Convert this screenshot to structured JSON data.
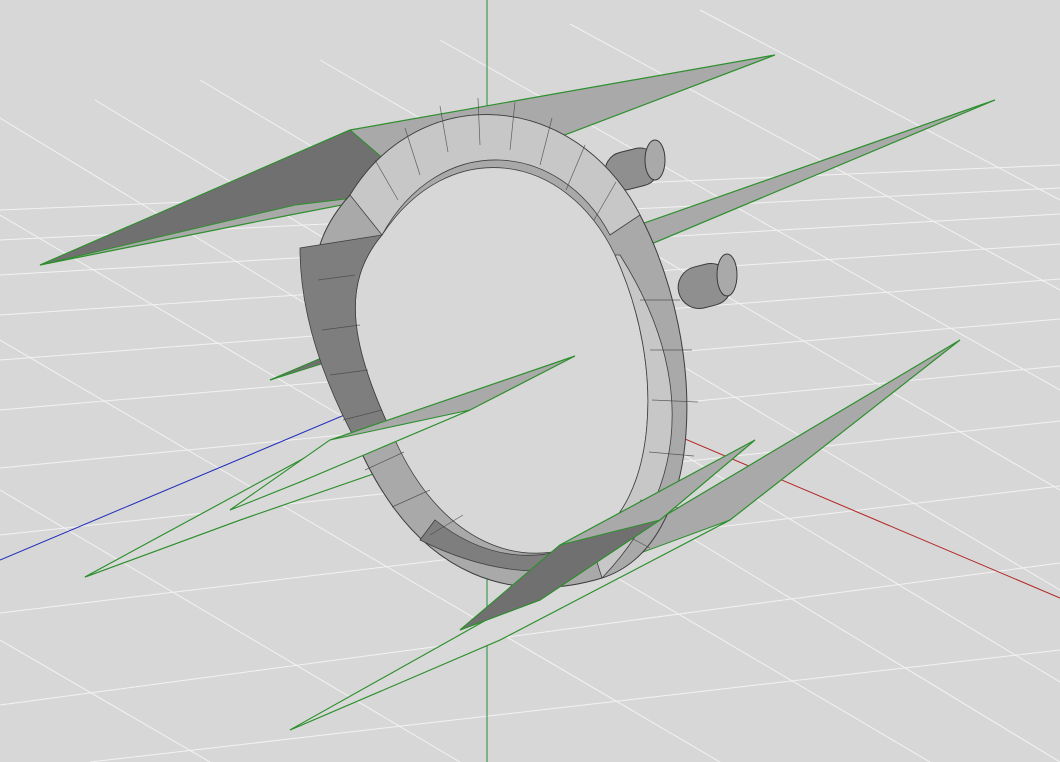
{
  "scene": {
    "colors": {
      "background": "#d7d7d7",
      "grid": "#f2f2f2",
      "axis_x": "#b22222",
      "axis_z": "#1f2dbb",
      "axis_y": "#1f8c3a",
      "mesh_edge": "#2d8f2d",
      "mesh_fill": "#a9a9a9"
    },
    "object": "spiked-ring-3d-model"
  }
}
